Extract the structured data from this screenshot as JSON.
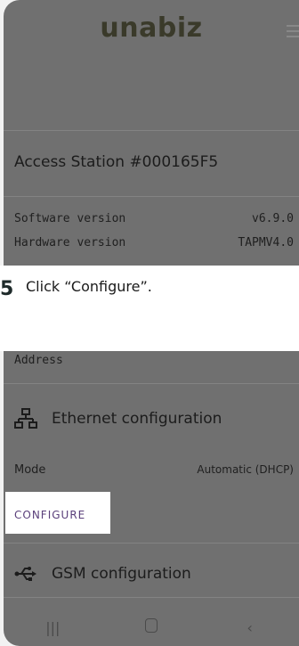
{
  "app": {
    "logo": "unabiz"
  },
  "station": {
    "title": "Access Station #000165F5"
  },
  "info": [
    {
      "label": "Software version",
      "value": "v6.9.0"
    },
    {
      "label": "Hardware version",
      "value": "TAPMV4.0"
    }
  ],
  "instruction": {
    "step": "5",
    "text": "Click “Configure”."
  },
  "address_label": "Address",
  "ethernet": {
    "title": "Ethernet configuration",
    "mode_label": "Mode",
    "mode_value": "Automatic (DHCP)",
    "configure_label": "CONFIGURE"
  },
  "gsm": {
    "title": "GSM configuration"
  },
  "icons": {
    "ethernet": "ethernet-network-icon",
    "gsm": "usb-icon",
    "menu": "hamburger-menu-icon"
  }
}
